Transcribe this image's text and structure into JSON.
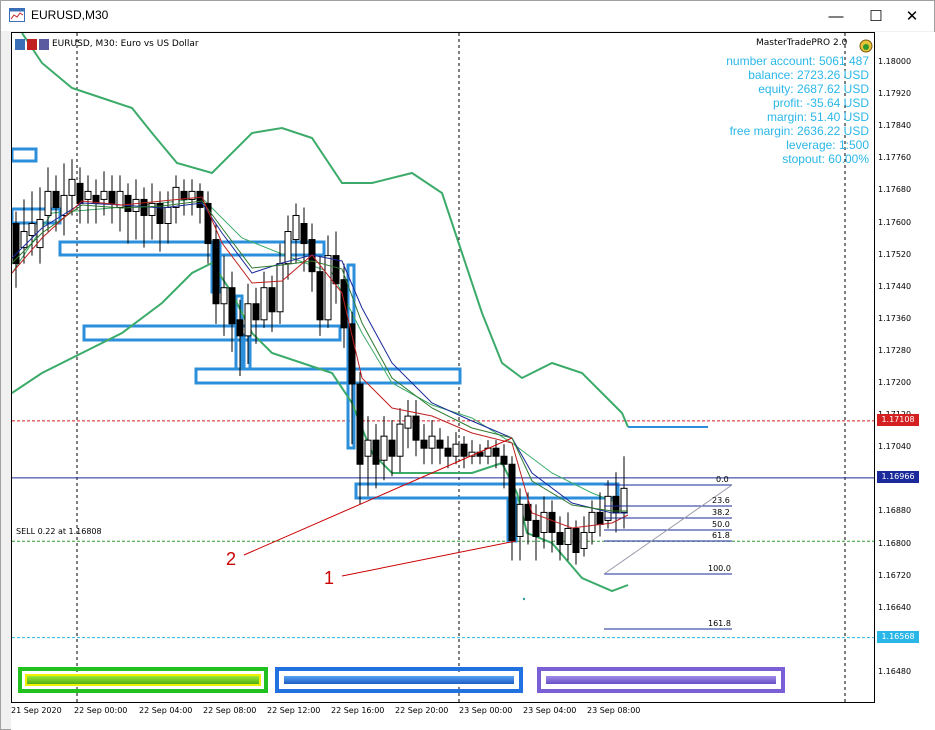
{
  "window": {
    "title": "EURUSD,M30",
    "symbol_description": "EURUSD, M30:  Euro vs US Dollar",
    "ea_name": "MasterTradePRO 2.0"
  },
  "account_info": [
    "number account: 5061 487",
    "balance: 2723.26 USD",
    "equity: 2687.62 USD",
    "profit: -35.64 USD",
    "margin: 51.40 USD",
    "free margin: 2636.22 USD",
    "leverage: 1:500",
    "stopout: 60.00%"
  ],
  "price_axis": [
    "1.18000",
    "1.17920",
    "1.17840",
    "1.17760",
    "1.17680",
    "1.17600",
    "1.17520",
    "1.17440",
    "1.17360",
    "1.17280",
    "1.17200",
    "1.17120",
    "1.17040",
    "1.16960",
    "1.16880",
    "1.16800",
    "1.16720",
    "1.16640",
    "1.16560",
    "1.16480"
  ],
  "price_tags": [
    {
      "value": "1.17108",
      "color": "#d42020"
    },
    {
      "value": "1.16966",
      "color": "#1a2a9a"
    },
    {
      "value": "1.16568",
      "color": "#2ab7e8"
    }
  ],
  "time_axis": [
    "21 Sep 2020",
    "22 Sep 00:00",
    "22 Sep 04:00",
    "22 Sep 08:00",
    "22 Sep 12:00",
    "22 Sep 16:00",
    "22 Sep 20:00",
    "23 Sep 00:00",
    "23 Sep 04:00",
    "23 Sep 08:00"
  ],
  "order_label": "SELL 0.22 at 1.16808",
  "fib_levels": [
    "0.0",
    "23.6",
    "38.2",
    "50.0",
    "61.8",
    "100.0",
    "161.8"
  ],
  "annotations": [
    "1",
    "2"
  ],
  "colors": {
    "bollinger": "#3cab6a",
    "zones": "#2b8fdc",
    "info_text": "#2ab7e8",
    "panel_green": "#21c21f",
    "panel_blue": "#2172e0",
    "panel_purple": "#7a5fd6",
    "annotation": "#cc0000"
  }
}
